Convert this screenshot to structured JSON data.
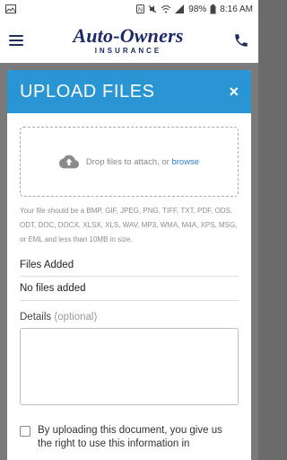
{
  "status_bar": {
    "battery": "98%",
    "time": "8:16 AM"
  },
  "header": {
    "brand_main": "Auto-Owners",
    "brand_sub": "INSURANCE"
  },
  "modal": {
    "title": "UPLOAD FILES",
    "close_icon": "×",
    "dropzone": {
      "text": "Drop files to attach, or",
      "link": "browse"
    },
    "hint": "Your file should be a BMP, GIF, JPEG, PNG, TIFF, TXT, PDF, ODS, ODT, DOC, DOCX, XLSX, XLS, WAV, MP3, WMA, M4A, XPS, MSG, or EML and less than 10MB in size.",
    "files_added_label": "Files Added",
    "no_files_text": "No files added",
    "details_label": "Details",
    "details_optional": "(optional)",
    "consent_text": "By uploading this document, you give us the right to use this information in"
  }
}
